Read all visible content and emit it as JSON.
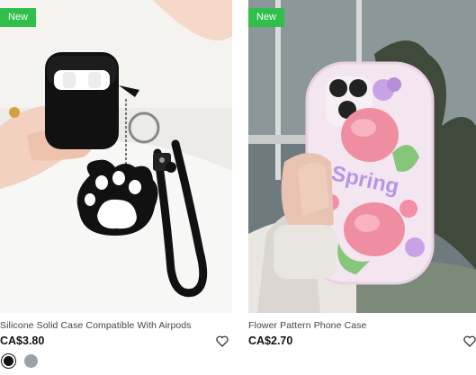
{
  "products": [
    {
      "badge": "New",
      "title": "Silicone Solid Case Compatible With Airpods",
      "price": "CA$3.80",
      "image": "airpods-case-paw-keychain",
      "wishlist_icon": "heart-outline-icon",
      "swatches": [
        {
          "color": "#111111",
          "selected": true
        },
        {
          "color": "#9aa1a8",
          "selected": false
        }
      ]
    },
    {
      "badge": "New",
      "title": "Flower Pattern Phone Case",
      "price": "CA$2.70",
      "image": "flower-pattern-phone-case",
      "wishlist_icon": "heart-outline-icon"
    }
  ],
  "colors": {
    "badge_bg": "#2fbf4a",
    "badge_text": "#ffffff",
    "price_text": "#111111"
  }
}
